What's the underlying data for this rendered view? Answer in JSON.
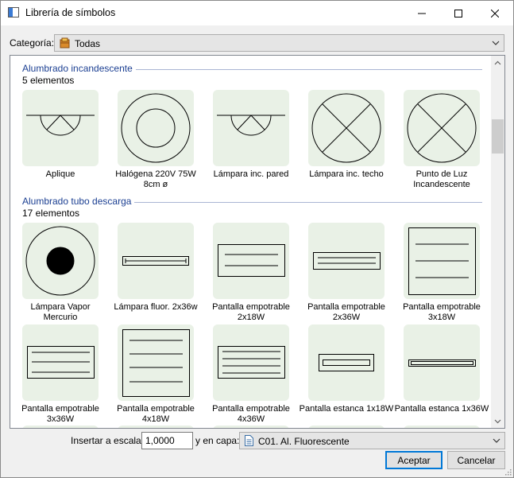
{
  "window": {
    "title": "Librería de símbolos"
  },
  "controls": {
    "minimize": "─",
    "maximize": "☐",
    "close": "✕"
  },
  "category": {
    "label": "Categoría:",
    "value": "Todas",
    "icon": "folder-box-icon"
  },
  "sections": [
    {
      "title": "Alumbrado incandescente",
      "count": "5 elementos",
      "items": [
        {
          "label": "Aplique",
          "symbol": "aplique"
        },
        {
          "label": "Halógena 220V 75W 8cm ø",
          "symbol": "halogena"
        },
        {
          "label": "Lámpara inc. pared",
          "symbol": "aplique"
        },
        {
          "label": "Lámpara inc. techo",
          "symbol": "cross-circle"
        },
        {
          "label": "Punto de Luz Incandescente",
          "symbol": "cross-circle"
        }
      ]
    },
    {
      "title": "Alumbrado tubo descarga",
      "count": "17 elementos",
      "items": [
        {
          "label": "Lámpara Vapor Mercurio",
          "symbol": "vapor-mercurio"
        },
        {
          "label": "Lámpara fluor. 2x36w",
          "symbol": "fluor-tube"
        },
        {
          "label": "Pantalla empotrable 2x18W",
          "symbol": "pantalla-2x18"
        },
        {
          "label": "Pantalla empotrable 2x36W",
          "symbol": "pantalla-2x36"
        },
        {
          "label": "Pantalla empotrable 3x18W",
          "symbol": "pantalla-3x18"
        },
        {
          "label": "Pantalla empotrable 3x36W",
          "symbol": "pantalla-3x36"
        },
        {
          "label": "Pantalla empotrable 4x18W",
          "symbol": "pantalla-4x18"
        },
        {
          "label": "Pantalla empotrable 4x36W",
          "symbol": "pantalla-4x36"
        },
        {
          "label": "Pantalla estanca 1x18W",
          "symbol": "estanca-1x18"
        },
        {
          "label": "Pantalla estanca 1x36W",
          "symbol": "estanca-1x36"
        }
      ]
    }
  ],
  "footer": {
    "scale_label": "Insertar a escala:",
    "scale_value": "1,0000",
    "layer_label": "y en capa:",
    "layer_value": "C01. Al. Fluorescente",
    "layer_icon": "document-icon",
    "accept": "Aceptar",
    "cancel": "Cancelar"
  },
  "colors": {
    "tile_bg": "#e9f1e6",
    "section_title": "#1b3f92",
    "accent": "#0078d7"
  }
}
